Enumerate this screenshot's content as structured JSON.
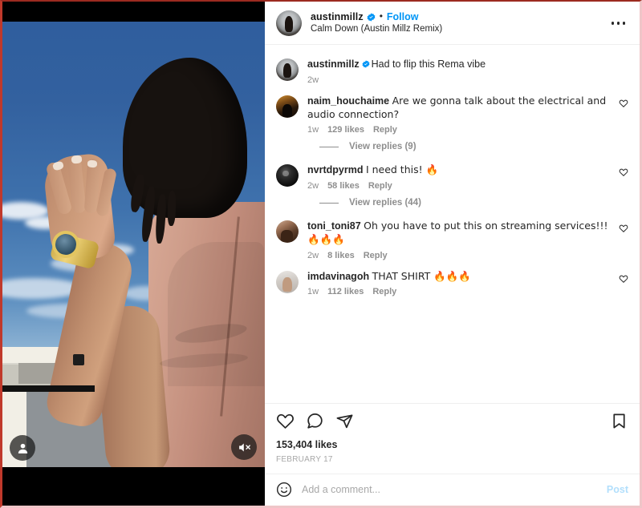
{
  "post": {
    "author": "austinmillz",
    "author_verified": true,
    "follow_label": "Follow",
    "separator": "•",
    "audio_title": "Calm Down (Austin Millz Remix)",
    "more_options_label": "More options",
    "likes": "153,404 likes",
    "date": "FEBRUARY 17"
  },
  "media": {
    "tag_icon": "person-tag-icon",
    "mute_icon": "speaker-muted-icon"
  },
  "caption": {
    "user": "austinmillz",
    "verified": true,
    "text": "Had to flip this Rema vibe",
    "time": "2w"
  },
  "comments": [
    {
      "user": "naim_houchaime",
      "text": "Are we gonna talk about the electrical and audio connection?",
      "time": "1w",
      "likes": "129 likes",
      "reply": "Reply",
      "avatar_class": "av-naim",
      "view_replies": "View replies (9)"
    },
    {
      "user": "nvrtdpyrmd",
      "text": "I need this! 🔥",
      "time": "2w",
      "likes": "58 likes",
      "reply": "Reply",
      "avatar_class": "av-nvrt",
      "view_replies": "View replies (44)"
    },
    {
      "user": "toni_toni87",
      "text": "Oh you have to put this on streaming services!!! 🔥🔥🔥",
      "time": "2w",
      "likes": "8 likes",
      "reply": "Reply",
      "avatar_class": "av-toni",
      "view_replies": null
    },
    {
      "user": "imdavinagoh",
      "text": "THAT SHIRT 🔥🔥🔥",
      "time": "1w",
      "likes": "112 likes",
      "reply": "Reply",
      "avatar_class": "av-davina",
      "view_replies": null
    }
  ],
  "actions": {
    "like_icon": "heart-icon",
    "comment_icon": "comment-bubble-icon",
    "share_icon": "share-paper-plane-icon",
    "save_icon": "bookmark-icon"
  },
  "add_comment": {
    "emoji_icon": "emoji-smiley-icon",
    "placeholder": "Add a comment...",
    "post_label": "Post"
  },
  "colors": {
    "accent_blue": "#0095F6",
    "post_blue_disabled": "#B2DFFC",
    "text_primary": "#262626",
    "text_secondary": "#8E8E8E"
  }
}
